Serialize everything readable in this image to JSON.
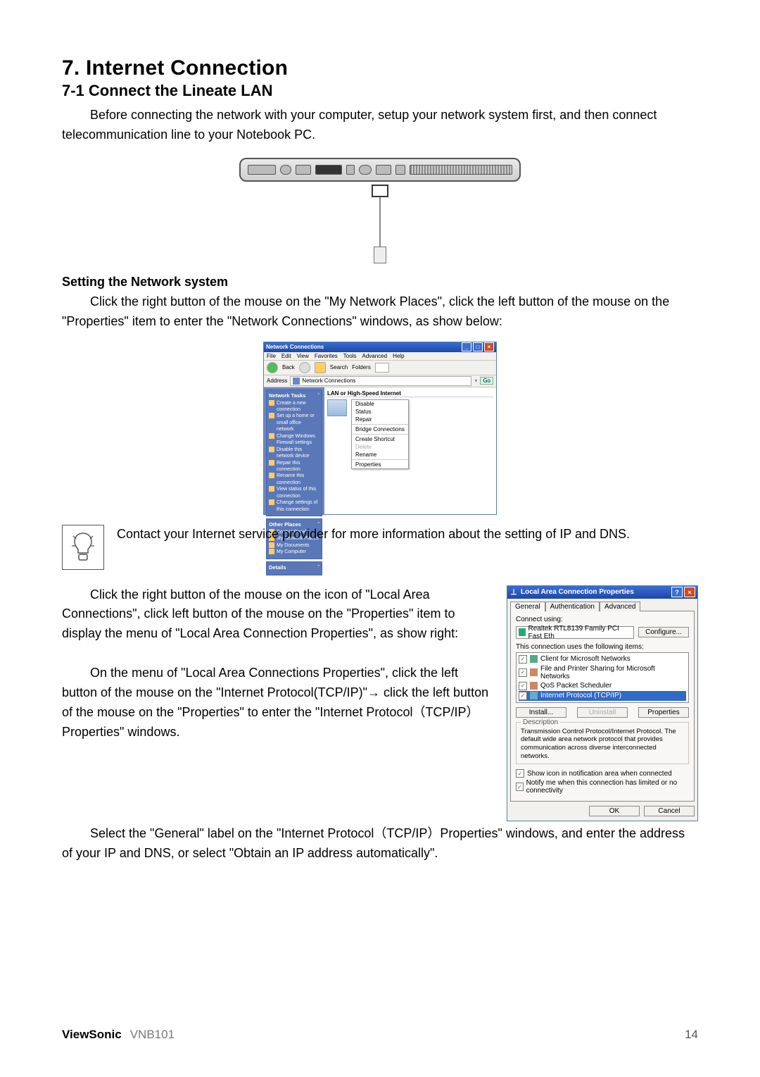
{
  "chapter": {
    "number": "7.",
    "title": "Internet Connection"
  },
  "section": {
    "number": "7-1",
    "title": "Connect the Lineate LAN"
  },
  "intro": "Before connecting the network with your computer, setup your network system first, and then connect telecommunication line to your Notebook PC.",
  "sub1": "Setting the Network system",
  "para1": "Click the right button of the mouse on the \"My Network Places\", click the left button of the mouse on the \"Properties\" item to enter the \"Network Connections\" windows, as show below:",
  "tip": "Contact your Internet service provider for more information about the setting of IP and DNS.",
  "para2": "Click the right button of the mouse on the icon of \"Local Area Connections\", click left button of the mouse on the \"Properties\" item to display the menu of \"Local Area Connection Properties\", as show right:",
  "para3": "On the menu of \"Local Area Connections Properties\", click the left button of the mouse on the \"Internet Protocol(TCP/IP)\"→ click the left button of the mouse on the \"Properties\" to enter the \"Internet Protocol（TCP/IP）Properties\" windows.",
  "para4": "Select the \"General\" label on the \"Internet Protocol（TCP/IP）Properties\" windows, and enter the address of your IP and DNS, or select \"Obtain an IP address automatically\".",
  "footer": {
    "brand": "ViewSonic",
    "model": "VNB101",
    "page": "14"
  },
  "nc": {
    "title": "Network Connections",
    "menu": [
      "File",
      "Edit",
      "View",
      "Favorites",
      "Tools",
      "Advanced",
      "Help"
    ],
    "toolbar": {
      "back": "Back",
      "search": "Search",
      "folders": "Folders"
    },
    "address_label": "Address",
    "address_value": "Network Connections",
    "go": "Go",
    "side": {
      "tasks_hd": "Network Tasks",
      "tasks": [
        "Create a new connection",
        "Set up a home or small office network",
        "Change Windows Firewall settings",
        "Disable this network device",
        "Repair this connection",
        "Rename this connection",
        "View status of this connection",
        "Change settings of this connection"
      ],
      "other_hd": "Other Places",
      "other": [
        "Control Panel",
        "My Network Places",
        "My Documents",
        "My Computer"
      ],
      "details_hd": "Details"
    },
    "group": "LAN or High-Speed Internet",
    "ctx": [
      "Disable",
      "Status",
      "Repair",
      "Bridge Connections",
      "Create Shortcut",
      "Delete",
      "Rename",
      "Properties"
    ]
  },
  "dlg": {
    "title": "Local Area Connection Properties",
    "tabs": [
      "General",
      "Authentication",
      "Advanced"
    ],
    "connect_using": "Connect using:",
    "adapter": "Realtek RTL8139 Family PCI Fast Eth",
    "configure": "Configure...",
    "items_label": "This connection uses the following items:",
    "items": [
      "Client for Microsoft Networks",
      "File and Printer Sharing for Microsoft Networks",
      "QoS Packet Scheduler",
      "Internet Protocol (TCP/IP)"
    ],
    "install": "Install...",
    "uninstall": "Uninstall",
    "properties": "Properties",
    "desc_label": "Description",
    "desc": "Transmission Control Protocol/Internet Protocol. The default wide area network protocol that provides communication across diverse interconnected networks.",
    "show_icon": "Show icon in notification area when connected",
    "notify": "Notify me when this connection has limited or no connectivity",
    "ok": "OK",
    "cancel": "Cancel",
    "help": "?",
    "close": "×"
  }
}
